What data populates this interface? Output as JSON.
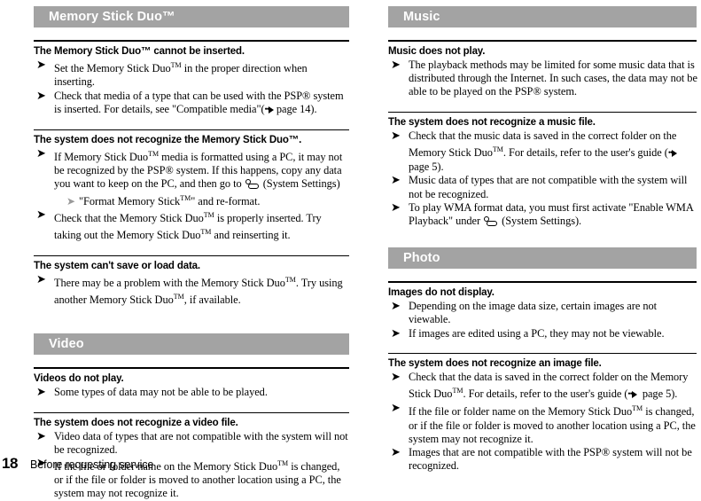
{
  "page": {
    "number": "18",
    "footer_title": "Before requesting service",
    "band_color": "#a3a3a3",
    "band_text_color": "#ffffff"
  },
  "icons": {
    "arrow": "➜",
    "sub_arrow": "➜",
    "system_settings": "system-settings-icon",
    "page_reference_dots": "••"
  },
  "left_column": {
    "sections": [
      {
        "band": "Memory Stick Duo™",
        "entries": [
          {
            "heading": "The Memory Stick Duo™ cannot be inserted.",
            "items": [
              {
                "text": "Set the Memory Stick Duo™ in the proper direction when inserting."
              },
              {
                "text": "Check that media of a type that can be used with the PSP® system is inserted. For details, see \"Compatible media\"(••▶ page 14)."
              }
            ]
          },
          {
            "heading": "The system does not recognize the Memory Stick Duo™.",
            "items": [
              {
                "text": "If Memory Stick Duo™ media is formatted using a PC, it may not be recognized by the PSP® system. If this happens, copy any data you want to keep on the PC, and then go to ⌘ (System Settings) ➜ \"Format Memory Stick™\" and re-format."
              },
              {
                "text": "Check that the Memory Stick Duo™ is properly inserted. Try taking out the Memory Stick Duo™ and reinserting it."
              }
            ]
          },
          {
            "heading": "The system can't save or load data.",
            "items": [
              {
                "text": "There may be a problem with the Memory Stick Duo™. Try using another Memory Stick Duo™, if available."
              }
            ]
          }
        ]
      },
      {
        "band": "Video",
        "entries": [
          {
            "heading": "Videos do not play.",
            "items": [
              {
                "text": "Some types of data may not be able to be played."
              }
            ]
          },
          {
            "heading": "The system does not recognize a video file.",
            "items": [
              {
                "text": "Video data of types that are not compatible with the system will not be recognized."
              },
              {
                "text": "If the file or folder name on the Memory Stick Duo™ is changed, or if the file or folder is moved to another location using a PC, the system may not recognize it."
              }
            ]
          }
        ]
      }
    ]
  },
  "right_column": {
    "sections": [
      {
        "band": "Music",
        "entries": [
          {
            "heading": "Music does not play.",
            "items": [
              {
                "text": "The playback methods may be limited for some music data that is distributed through the Internet. In such cases, the data may not be able to be played on the PSP® system."
              }
            ]
          },
          {
            "heading": "The system does not recognize a music file.",
            "items": [
              {
                "text": "Check that the music data is saved in the correct folder on the Memory Stick Duo™. For details, refer to the user's guide (••▶ page 5)."
              },
              {
                "text": "Music data of types that are not compatible with the system will not be recognized."
              },
              {
                "text": "To play WMA format data, you must first activate \"Enable WMA Playback\" under ⌘ (System Settings)."
              }
            ]
          }
        ]
      },
      {
        "band": "Photo",
        "entries": [
          {
            "heading": "Images do not display.",
            "items": [
              {
                "text": "Depending on the image data size, certain images are not viewable."
              },
              {
                "text": "If images are edited using a PC, they may not be viewable."
              }
            ]
          },
          {
            "heading": "The system does not recognize an image file.",
            "items": [
              {
                "text": "Check that the data is saved in the correct folder on the Memory Stick Duo™. For details, refer to the user's guide (••▶ page 5)."
              },
              {
                "text": "If the file or folder name on the Memory Stick Duo™ is changed, or if the file or folder is moved to another location using a PC, the system may not recognize it."
              },
              {
                "text": "Images that are not compatible with the PSP® system will not be recognized."
              }
            ]
          }
        ]
      }
    ]
  },
  "text_fragments": {
    "ms_duo": "Memory Stick Duo",
    "tm": "™",
    "psp": "PSP®",
    "system_settings_label": "(System Settings)",
    "format_ms": "\"Format Memory Stick™\" and re-format.",
    "page14": "page 14",
    "page5": "page 5"
  }
}
